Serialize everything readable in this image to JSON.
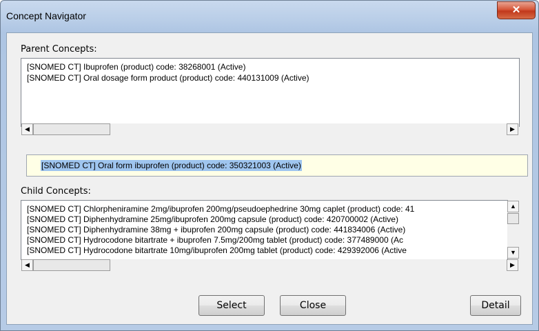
{
  "window": {
    "title": "Concept Navigator",
    "close_glyph": "✕"
  },
  "parent": {
    "label": "Parent Concepts:",
    "items": [
      "[SNOMED CT] Ibuprofen (product) code: 38268001 (Active)",
      "[SNOMED CT] Oral dosage form product (product) code: 440131009 (Active)"
    ]
  },
  "selected": {
    "text": "[SNOMED CT] Oral form ibuprofen (product) code: 350321003 (Active)"
  },
  "child": {
    "label": "Child Concepts:",
    "items": [
      "[SNOMED CT] Chlorpheniramine 2mg/ibuprofen 200mg/pseudoephedrine 30mg caplet (product) code: 41",
      "[SNOMED CT] Diphenhydramine 25mg/ibuprofen 200mg capsule (product) code: 420700002 (Active)",
      "[SNOMED CT] Diphenhydramine 38mg + ibuprofen 200mg capsule (product) code: 441834006 (Active)",
      "[SNOMED CT] Hydrocodone bitartrate + ibuprofen 7.5mg/200mg tablet (product) code: 377489000 (Ac",
      "[SNOMED CT] Hydrocodone bitartrate 10mg/ibuprofen 200mg tablet (product) code: 429392006 (Active"
    ]
  },
  "buttons": {
    "select": "Select",
    "close": "Close",
    "detail": "Detail"
  },
  "icons": {
    "left": "◀",
    "right": "▶",
    "up": "▲",
    "down": "▼"
  }
}
